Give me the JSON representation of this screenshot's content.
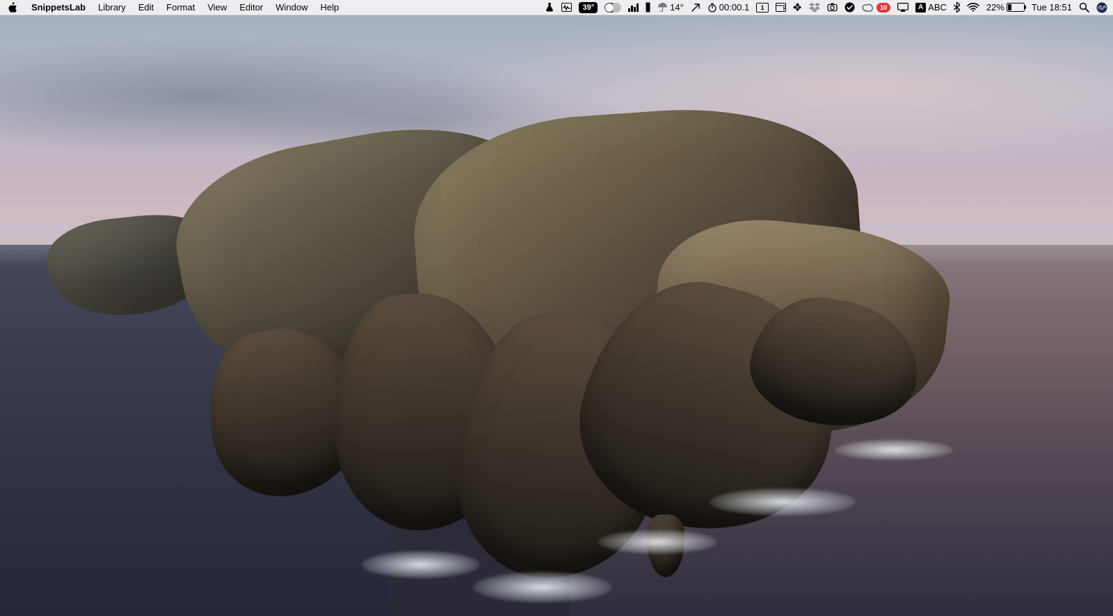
{
  "menubar": {
    "app_name": "SnippetsLab",
    "items": [
      "Library",
      "Edit",
      "Format",
      "View",
      "Editor",
      "Window",
      "Help"
    ]
  },
  "status": {
    "cpu_temp": "39°",
    "weather_temp": "14°",
    "timer": "00:00.1",
    "desktop_number": "1",
    "notification_count": "10",
    "input_source_letter": "A",
    "input_source_label": "ABC",
    "battery_percent": "22%",
    "clock": "Tue 18:51",
    "icons": {
      "lab": "flask-icon",
      "activity": "activity-monitor-icon",
      "toggle": "toggle-icon",
      "bars": "levels-icon",
      "disk": "disk-icon",
      "umbrella": "umbrella-icon",
      "vpn": "vpn-arrow-icon",
      "stopwatch": "stopwatch-icon",
      "window": "window-tool-icon",
      "hash": "grid-icon",
      "dropbox": "dropbox-icon",
      "camera": "camera-loop-icon",
      "check": "checkmark-badge-icon",
      "cc": "creative-cloud-icon",
      "airplay": "airplay-icon",
      "bluetooth": "bluetooth-icon",
      "wifi": "wifi-icon",
      "spotlight": "search-icon",
      "siri": "siri-icon"
    }
  },
  "system": {
    "wallpaper_name": "macOS Catalina"
  }
}
